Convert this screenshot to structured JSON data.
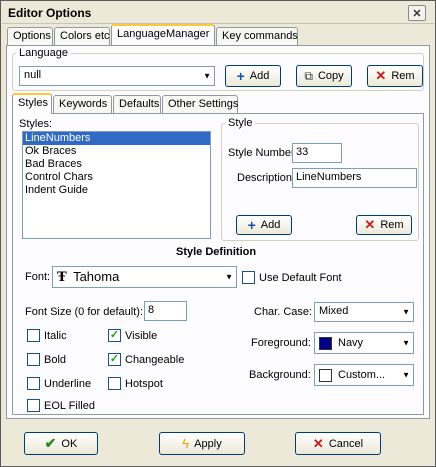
{
  "window": {
    "title": "Editor Options"
  },
  "close_glyph": "✕",
  "top_tabs": [
    {
      "label": "Options"
    },
    {
      "label": "Colors etc"
    },
    {
      "label": "LanguageManager"
    },
    {
      "label": "Key commands"
    }
  ],
  "language": {
    "group_label": "Language",
    "selected": "null",
    "add_label": "Add",
    "copy_label": "Copy",
    "remove_label": "Rem"
  },
  "sub_tabs": [
    {
      "label": "Styles"
    },
    {
      "label": "Keywords"
    },
    {
      "label": "Defaults"
    },
    {
      "label": "Other Settings"
    }
  ],
  "styles_list": {
    "label": "Styles:",
    "items": [
      "LineNumbers",
      "Ok Braces",
      "Bad Braces",
      "Control Chars",
      "Indent Guide"
    ]
  },
  "style": {
    "group_label": "Style",
    "number_label": "Style Number:",
    "number_value": "33",
    "description_label": "Description:",
    "description_value": "LineNumbers",
    "add_label": "Add",
    "remove_label": "Rem"
  },
  "style_definition": {
    "heading": "Style Definition",
    "font_label": "Font:",
    "font_icon": "Ŧ",
    "font_value": "Tahoma",
    "use_default_font_label": "Use Default Font",
    "font_size_label": "Font Size (0 for default):",
    "font_size_value": "8",
    "checkboxes": {
      "italic": {
        "label": "Italic",
        "checked": ""
      },
      "visible": {
        "label": "Visible",
        "checked": "✓"
      },
      "bold": {
        "label": "Bold",
        "checked": ""
      },
      "changeable": {
        "label": "Changeable",
        "checked": "✓"
      },
      "underline": {
        "label": "Underline",
        "checked": ""
      },
      "hotspot": {
        "label": "Hotspot",
        "checked": ""
      },
      "eol_filled": {
        "label": "EOL Filled",
        "checked": ""
      }
    },
    "char_case_label": "Char. Case:",
    "char_case_value": "Mixed",
    "foreground_label": "Foreground:",
    "foreground_value": "Navy",
    "foreground_color": "#000080",
    "background_label": "Background:",
    "background_value": "Custom...",
    "background_color": "#ffffff"
  },
  "footer": {
    "ok_label": "OK",
    "apply_label": "Apply",
    "cancel_label": "Cancel"
  },
  "icons": {
    "add": "+",
    "remove": "✕",
    "copy": "⧉",
    "ok": "✔",
    "apply": "ϟ",
    "dropdown": "▼"
  }
}
